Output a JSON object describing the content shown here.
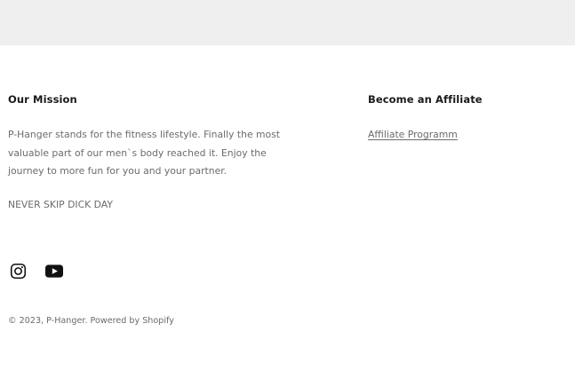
{
  "footer": {
    "mission": {
      "heading": "Our Mission",
      "text": "P-Hanger stands for the fitness lifestyle. Finally the most valuable part of our men`s body reached it. Enjoy the journey to more fun for you and your partner.",
      "tagline": "NEVER SKIP DICK DAY"
    },
    "affiliate": {
      "heading": "Become an Affiliate",
      "link_label": "Affiliate Programm"
    },
    "social": [
      {
        "name": "instagram-icon",
        "label": "Instagram"
      },
      {
        "name": "youtube-icon",
        "label": "YouTube"
      }
    ],
    "copyright": {
      "prefix": "© 2023, ",
      "brand": "P-Hanger",
      "separator": ". ",
      "powered": "Powered by Shopify"
    }
  },
  "colors": {
    "top_band": "#efefef",
    "heading": "#1a1a1a",
    "muted_text": "#6b6b6b",
    "icon": "#111111"
  }
}
